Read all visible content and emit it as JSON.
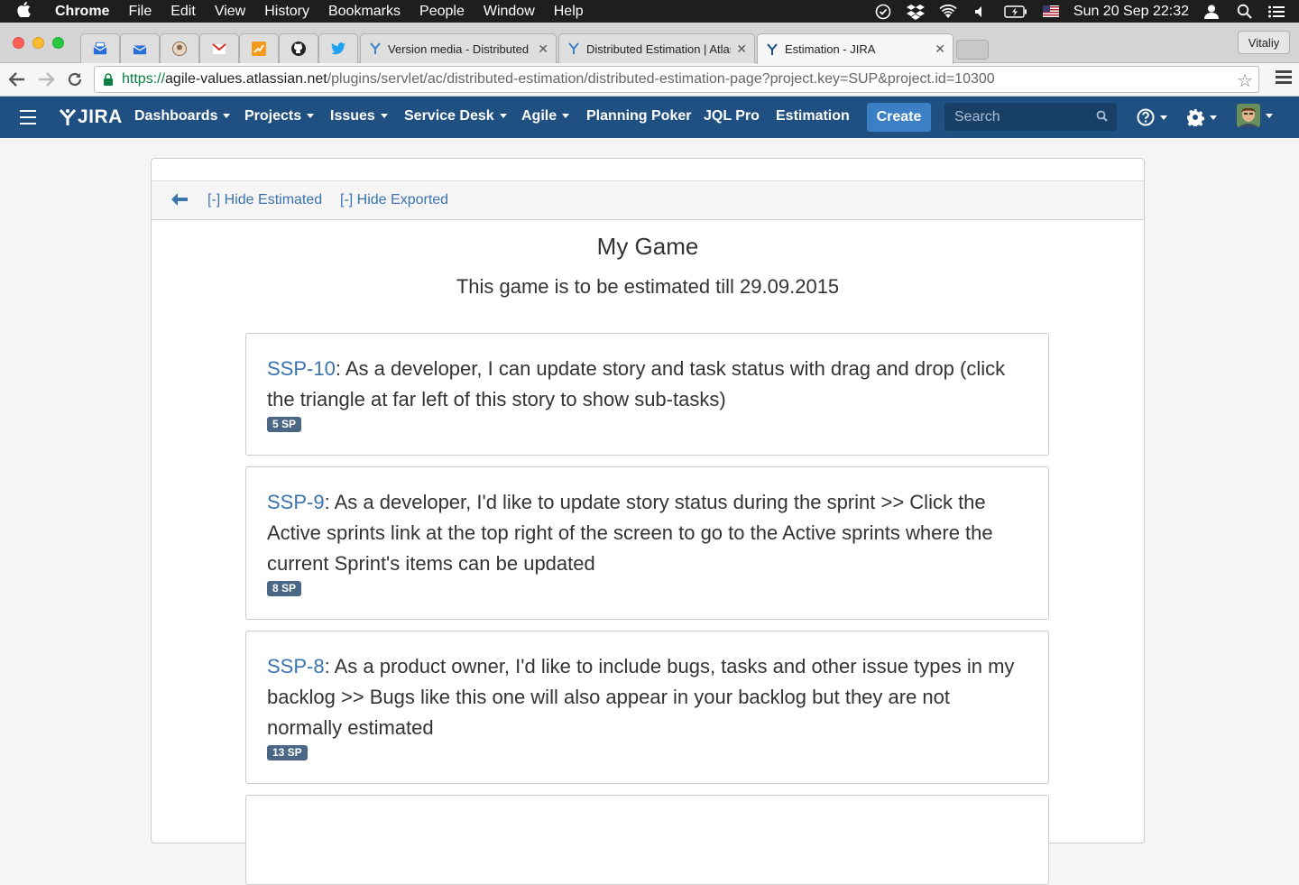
{
  "os_menubar": {
    "app_name": "Chrome",
    "menus": [
      "File",
      "Edit",
      "View",
      "History",
      "Bookmarks",
      "People",
      "Window",
      "Help"
    ],
    "clock": "Sun 20 Sep  22:32"
  },
  "browser": {
    "profile_name": "Vitaliy",
    "tabs": [
      {
        "title": "Version media - Distributed E",
        "active": false
      },
      {
        "title": "Distributed Estimation | Atlas",
        "active": false
      },
      {
        "title": "Estimation - JIRA",
        "active": true
      }
    ],
    "url_scheme": "https://",
    "url_host": "agile-values.atlassian.net",
    "url_path": "/plugins/servlet/ac/distributed-estimation/distributed-estimation-page?project.key=SUP&project.id=10300"
  },
  "jira_header": {
    "logo_text": "JIRA",
    "nav": {
      "dashboards": "Dashboards",
      "projects": "Projects",
      "issues": "Issues",
      "service_desk": "Service Desk",
      "agile": "Agile",
      "planning_poker": "Planning Poker",
      "jql_pro": "JQL Pro",
      "estimation": "Estimation"
    },
    "create_label": "Create",
    "search_placeholder": "Search"
  },
  "page": {
    "hide_estimated": "[-] Hide Estimated",
    "hide_exported": "[-] Hide Exported",
    "game_title": "My Game",
    "game_subtitle": "This game is to be estimated till 29.09.2015",
    "issues": [
      {
        "key": "SSP-10",
        "summary": ": As a developer, I can update story and task status with drag and drop (click the triangle at far left of this story to show sub-tasks)",
        "points": "5 SP"
      },
      {
        "key": "SSP-9",
        "summary": ": As a developer, I'd like to update story status during the sprint >> Click the Active sprints link at the top right of the screen to go to the Active sprints where the current Sprint's items can be updated",
        "points": "8 SP"
      },
      {
        "key": "SSP-8",
        "summary": ": As a product owner, I'd like to include bugs, tasks and other issue types in my backlog >> Bugs like this one will also appear in your backlog but they are not normally estimated",
        "points": "13 SP"
      }
    ]
  },
  "colors": {
    "jira_header_bg": "#205081",
    "create_button": "#3b7fc4",
    "link": "#3b73af",
    "sp_badge": "#4a6785"
  }
}
